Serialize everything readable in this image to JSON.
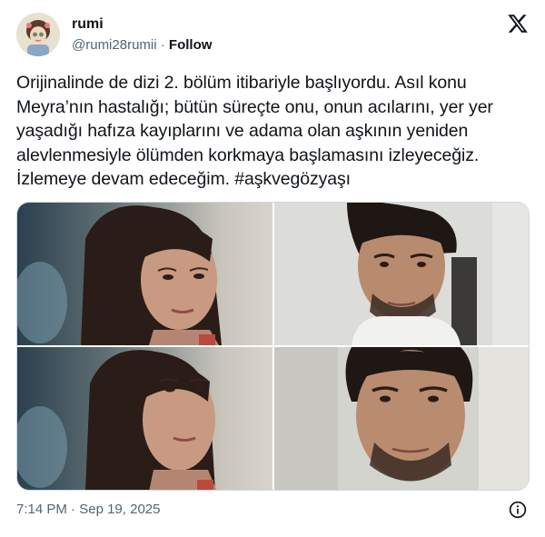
{
  "user": {
    "display_name": "rumi",
    "handle": "@rumi28rumii",
    "separator": "·",
    "follow_label": "Follow"
  },
  "tweet": {
    "text": "Orijinalinde de dizi 2. bölüm itibariyle başlıyordu. Asıl konu Meyra’nın hastalığı; bütün süreçte onu, onun acılarını, yer yer yaşadığı hafıza kayıplarını ve adama olan aşkının yeniden alevlenmesiyle ölümden korkmaya başlamasını izleyeceğiz. İzlemeye devam edeceğim.",
    "hashtag": "#aşkvegözyaşı"
  },
  "media": {
    "count": 4,
    "images": [
      "woman-closeup-neutral",
      "man-closeup-white-shirt",
      "woman-closeup-tearful",
      "man-closeup-intense"
    ]
  },
  "footer": {
    "time": "7:14 PM",
    "separator": "·",
    "date": "Sep 19, 2025"
  },
  "icons": {
    "platform_logo": "x-logo-icon",
    "info": "info-icon"
  },
  "colors": {
    "text_primary": "#0f1419",
    "text_secondary": "#536471",
    "border": "#cfd9de"
  }
}
